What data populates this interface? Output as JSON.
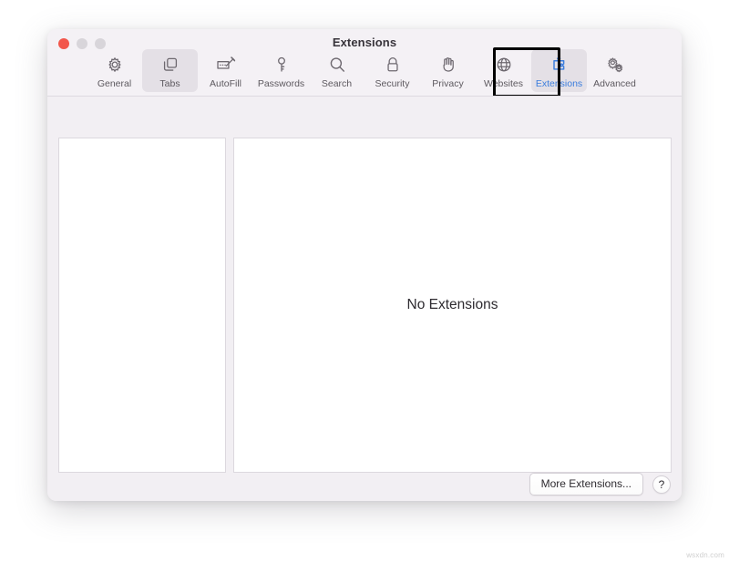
{
  "window": {
    "title": "Extensions",
    "traffic_lights": [
      {
        "name": "close",
        "color": "#f2564b"
      },
      {
        "name": "minimize",
        "color": "#d8d5da"
      },
      {
        "name": "zoom",
        "color": "#d8d5da"
      }
    ]
  },
  "toolbar": {
    "items": [
      {
        "label": "General",
        "icon": "gear-icon",
        "state": "normal"
      },
      {
        "label": "Tabs",
        "icon": "tabs-icon",
        "state": "selected"
      },
      {
        "label": "AutoFill",
        "icon": "autofill-icon",
        "state": "normal"
      },
      {
        "label": "Passwords",
        "icon": "key-icon",
        "state": "normal"
      },
      {
        "label": "Search",
        "icon": "magnifier-icon",
        "state": "normal"
      },
      {
        "label": "Security",
        "icon": "lock-icon",
        "state": "normal"
      },
      {
        "label": "Privacy",
        "icon": "hand-icon",
        "state": "normal"
      },
      {
        "label": "Websites",
        "icon": "globe-icon",
        "state": "normal"
      },
      {
        "label": "Extensions",
        "icon": "puzzle-icon",
        "state": "active"
      },
      {
        "label": "Advanced",
        "icon": "gears-icon",
        "state": "normal"
      }
    ],
    "active_accent_color": "#3b7ddd",
    "selected_background": "#e4e0e6"
  },
  "annotation": {
    "target": "Extensions",
    "color": "#000000"
  },
  "main": {
    "extensions_list": [],
    "empty_message": "No Extensions"
  },
  "footer": {
    "more_extensions_label": "More Extensions...",
    "help_label": "?"
  },
  "watermark": {
    "text": "wsxdn.com"
  }
}
